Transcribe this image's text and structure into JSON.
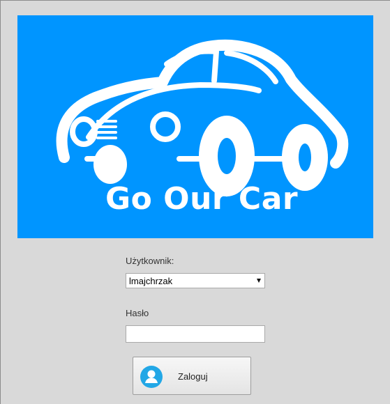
{
  "logo": {
    "text": "Go Our Car",
    "background_color": "#0095ff",
    "icon": "car-logo-icon"
  },
  "form": {
    "user_label": "Użytkownik:",
    "user_value": "lmajchrzak",
    "password_label": "Hasło",
    "password_value": "",
    "login_label": "Zaloguj",
    "login_icon": "user-icon"
  },
  "colors": {
    "window_background": "#d9d9d9",
    "icon_accent": "#22a7e6"
  }
}
